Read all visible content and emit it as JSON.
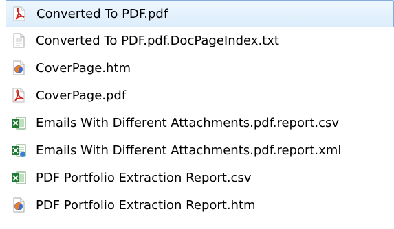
{
  "files": [
    {
      "name": "Converted To PDF.pdf",
      "icon": "pdf-file-icon",
      "selected": true
    },
    {
      "name": "Converted To PDF.pdf.DocPageIndex.txt",
      "icon": "text-file-icon",
      "selected": false
    },
    {
      "name": "CoverPage.htm",
      "icon": "html-file-icon",
      "selected": false
    },
    {
      "name": "CoverPage.pdf",
      "icon": "pdf-file-icon",
      "selected": false
    },
    {
      "name": "Emails With Different Attachments.pdf.report.csv",
      "icon": "csv-file-icon",
      "selected": false
    },
    {
      "name": "Emails With Different Attachments.pdf.report.xml",
      "icon": "xml-file-icon",
      "selected": false
    },
    {
      "name": "PDF Portfolio Extraction Report.csv",
      "icon": "csv-file-icon",
      "selected": false
    },
    {
      "name": "PDF Portfolio Extraction Report.htm",
      "icon": "html-file-icon",
      "selected": false
    }
  ],
  "colors": {
    "selection_fill": "#dcedfc",
    "selection_border": "#84acdd",
    "pdf_red": "#d0241c",
    "excel_green": "#1f7a32"
  }
}
